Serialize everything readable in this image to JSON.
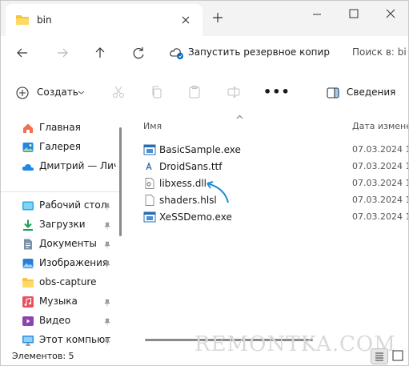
{
  "tab": {
    "title": "bin"
  },
  "address": {
    "backup_label": "Запустить резервное копир",
    "search_placeholder": "Поиск в: bi"
  },
  "commandbar": {
    "create_label": "Создать",
    "more_label": "•••",
    "details_label": "Сведения"
  },
  "sidebar": {
    "top": [
      {
        "label": "Главная",
        "icon": "home-icon"
      },
      {
        "label": "Галерея",
        "icon": "gallery-icon"
      },
      {
        "label": "Дмитрий — Личн",
        "icon": "onedrive-cloud-icon"
      }
    ],
    "pinned": [
      {
        "label": "Рабочий стол",
        "icon": "desktop-icon",
        "pinned": true
      },
      {
        "label": "Загрузки",
        "icon": "downloads-icon",
        "pinned": true
      },
      {
        "label": "Документы",
        "icon": "documents-icon",
        "pinned": true
      },
      {
        "label": "Изображения",
        "icon": "pictures-icon",
        "pinned": true
      },
      {
        "label": "obs-capture",
        "icon": "folder-icon",
        "pinned": false
      },
      {
        "label": "Музыка",
        "icon": "music-icon",
        "pinned": true
      },
      {
        "label": "Видео",
        "icon": "video-icon",
        "pinned": true
      },
      {
        "label": "Этот компьют",
        "icon": "this-pc-icon",
        "pinned": true
      }
    ]
  },
  "filelist": {
    "columns": {
      "name": "Имя",
      "date": "Дата изменен"
    },
    "files": [
      {
        "name": "BasicSample.exe",
        "date": "07.03.2024 18",
        "icon": "exe-icon"
      },
      {
        "name": "DroidSans.ttf",
        "date": "07.03.2024 18",
        "icon": "font-file-icon"
      },
      {
        "name": "libxess.dll",
        "date": "07.03.2024 18",
        "icon": "dll-file-icon"
      },
      {
        "name": "shaders.hlsl",
        "date": "07.03.2024 18",
        "icon": "text-file-icon"
      },
      {
        "name": "XeSSDemo.exe",
        "date": "07.03.2024 18",
        "icon": "exe-icon"
      }
    ]
  },
  "status": {
    "count": "Элементов: 5",
    "watermark": "REMONTKA.COM"
  },
  "colors": {
    "accent": "#0067c0",
    "folder": "#f5c542",
    "annotation_arrow": "#1e8fd6"
  }
}
